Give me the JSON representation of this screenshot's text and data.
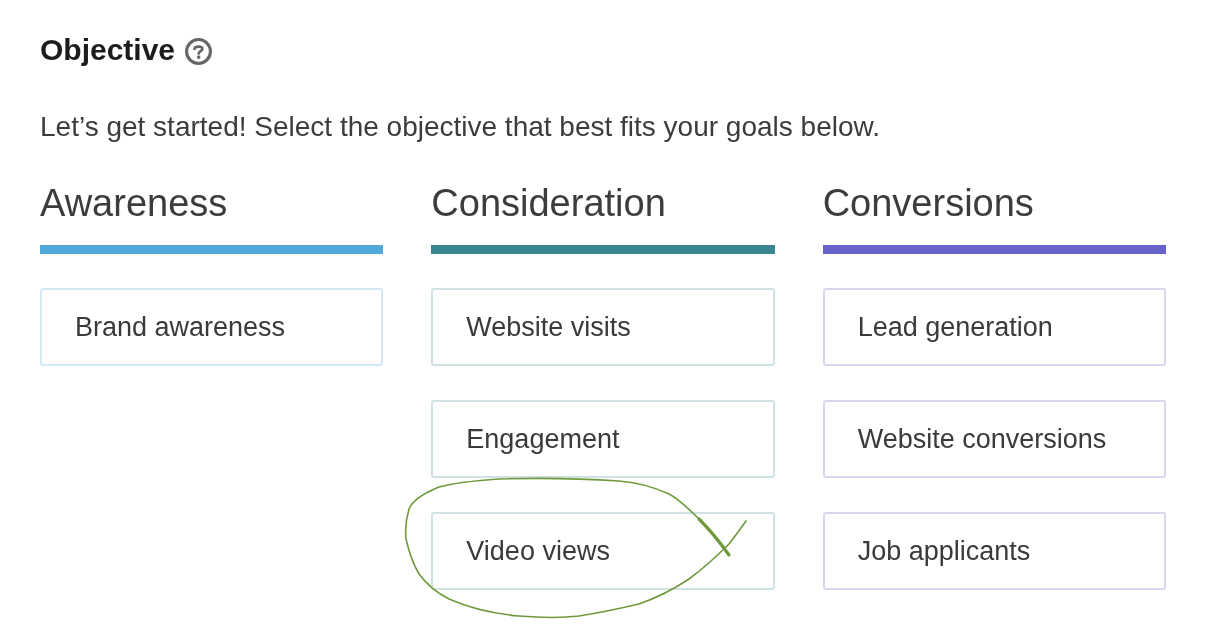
{
  "title": "Objective",
  "intro": "Let’s get started! Select the objective that best fits your goals below.",
  "categories": [
    {
      "name": "Awareness",
      "color": "#52a8d8",
      "options": [
        {
          "label": "Brand awareness",
          "circled": false
        }
      ]
    },
    {
      "name": "Consideration",
      "color": "#3a8690",
      "options": [
        {
          "label": "Website visits",
          "circled": false
        },
        {
          "label": "Engagement",
          "circled": false
        },
        {
          "label": "Video views",
          "circled": true
        }
      ]
    },
    {
      "name": "Conversions",
      "color": "#6562c9",
      "options": [
        {
          "label": "Lead generation",
          "circled": false
        },
        {
          "label": "Website conversions",
          "circled": false
        },
        {
          "label": "Job applicants",
          "circled": false
        }
      ]
    }
  ]
}
